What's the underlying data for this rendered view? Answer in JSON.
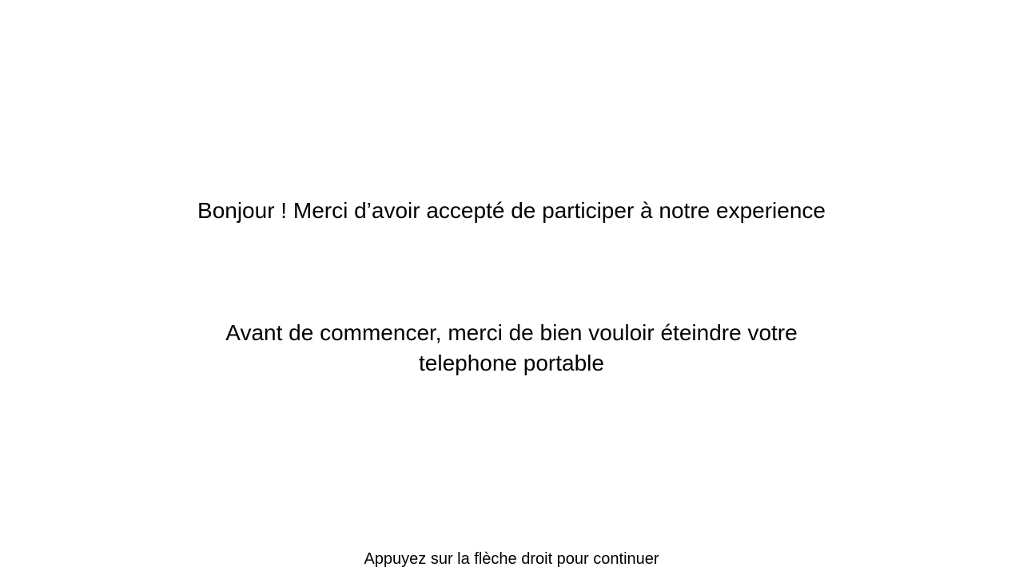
{
  "slide": {
    "greeting": "Bonjour ! Merci d’avoir accepté de participer à notre experience",
    "instruction_line1": "Avant de commencer, merci de bien vouloir éteindre votre",
    "instruction_line2": "telephone portable",
    "continue_hint": "Appuyez sur la flèche droit pour continuer"
  },
  "colors": {
    "background": "#ffffff",
    "text": "#000000"
  }
}
